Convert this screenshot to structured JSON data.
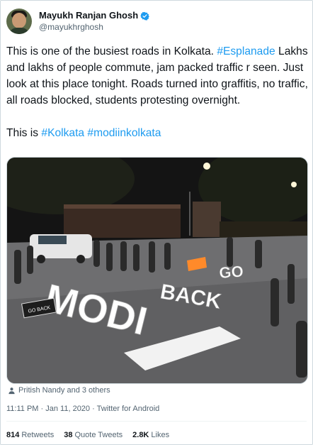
{
  "author": {
    "display_name": "Mayukh Ranjan Ghosh",
    "handle": "@mayukhrghosh",
    "verified": true,
    "verified_color": "#1d9bf0"
  },
  "tweet": {
    "para1_part1": "This is one of the busiest roads in Kolkata. ",
    "para1_tag": "#Esplanade",
    "para1_part2": " Lakhs and lakhs of people commute, jam packed traffic r seen. Just look at this place tonight. Roads turned into graffitis, no traffic, all roads blocked, students protesting overnight.",
    "para2_part1": "This is ",
    "para2_tag1": "#Kolkata",
    "para2_tag2": "#modiinkolkata",
    "link_color": "#1d9bf0"
  },
  "photo": {
    "road_texts": [
      "GO",
      "BACK",
      "MODI"
    ],
    "sign_text": "GO BACK"
  },
  "tagged": "Pritish Nandy and 3 others",
  "meta": {
    "time": "11:11 PM",
    "date": "Jan 11, 2020",
    "source": "Twitter for Android"
  },
  "stats": {
    "retweets_count": "814",
    "retweets_label": "Retweets",
    "quotes_count": "38",
    "quotes_label": "Quote Tweets",
    "likes_count": "2.8K",
    "likes_label": "Likes"
  }
}
